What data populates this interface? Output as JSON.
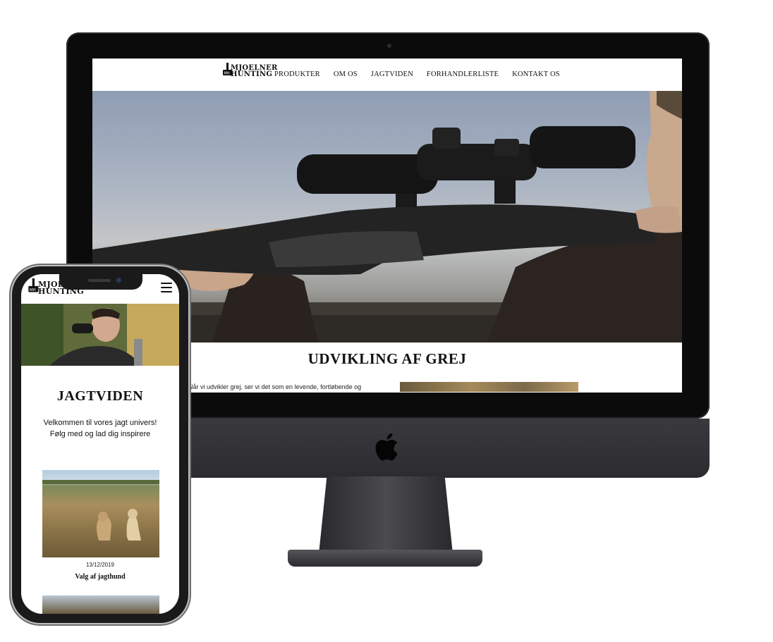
{
  "desktop": {
    "logo_text_line1": "MJOELNER",
    "logo_text_line2": "HUNTING",
    "nav": [
      {
        "label": "PRODUKTER"
      },
      {
        "label": "OM OS"
      },
      {
        "label": "JAGTVIDEN"
      },
      {
        "label": "FORHANDLERLISTE"
      },
      {
        "label": "KONTAKT OS"
      }
    ],
    "hero_image": "rifle-scope-hunter-photo",
    "section_title": "UDVIKLING AF GREJ",
    "section_text": "Når vi udvikler grej, ser vi det som en levende, fortløbende og"
  },
  "mobile": {
    "logo_text_line1": "MJOELNER",
    "logo_text_line2": "HUNTING",
    "menu_icon": "hamburger-icon",
    "hero_image": "binoculars-hunter-photo",
    "title": "JAGTVIDEN",
    "intro_line1": "Velkommen til vores jagt univers!",
    "intro_line2": "Følg med og lad dig inspirere",
    "posts": [
      {
        "image": "hunting-dogs-field-photo",
        "date": "13/12/2019",
        "title": "Valg af jagthund"
      }
    ]
  },
  "colors": {
    "bezel": "#0b0b0b",
    "chin": "#333337",
    "text": "#111111"
  }
}
